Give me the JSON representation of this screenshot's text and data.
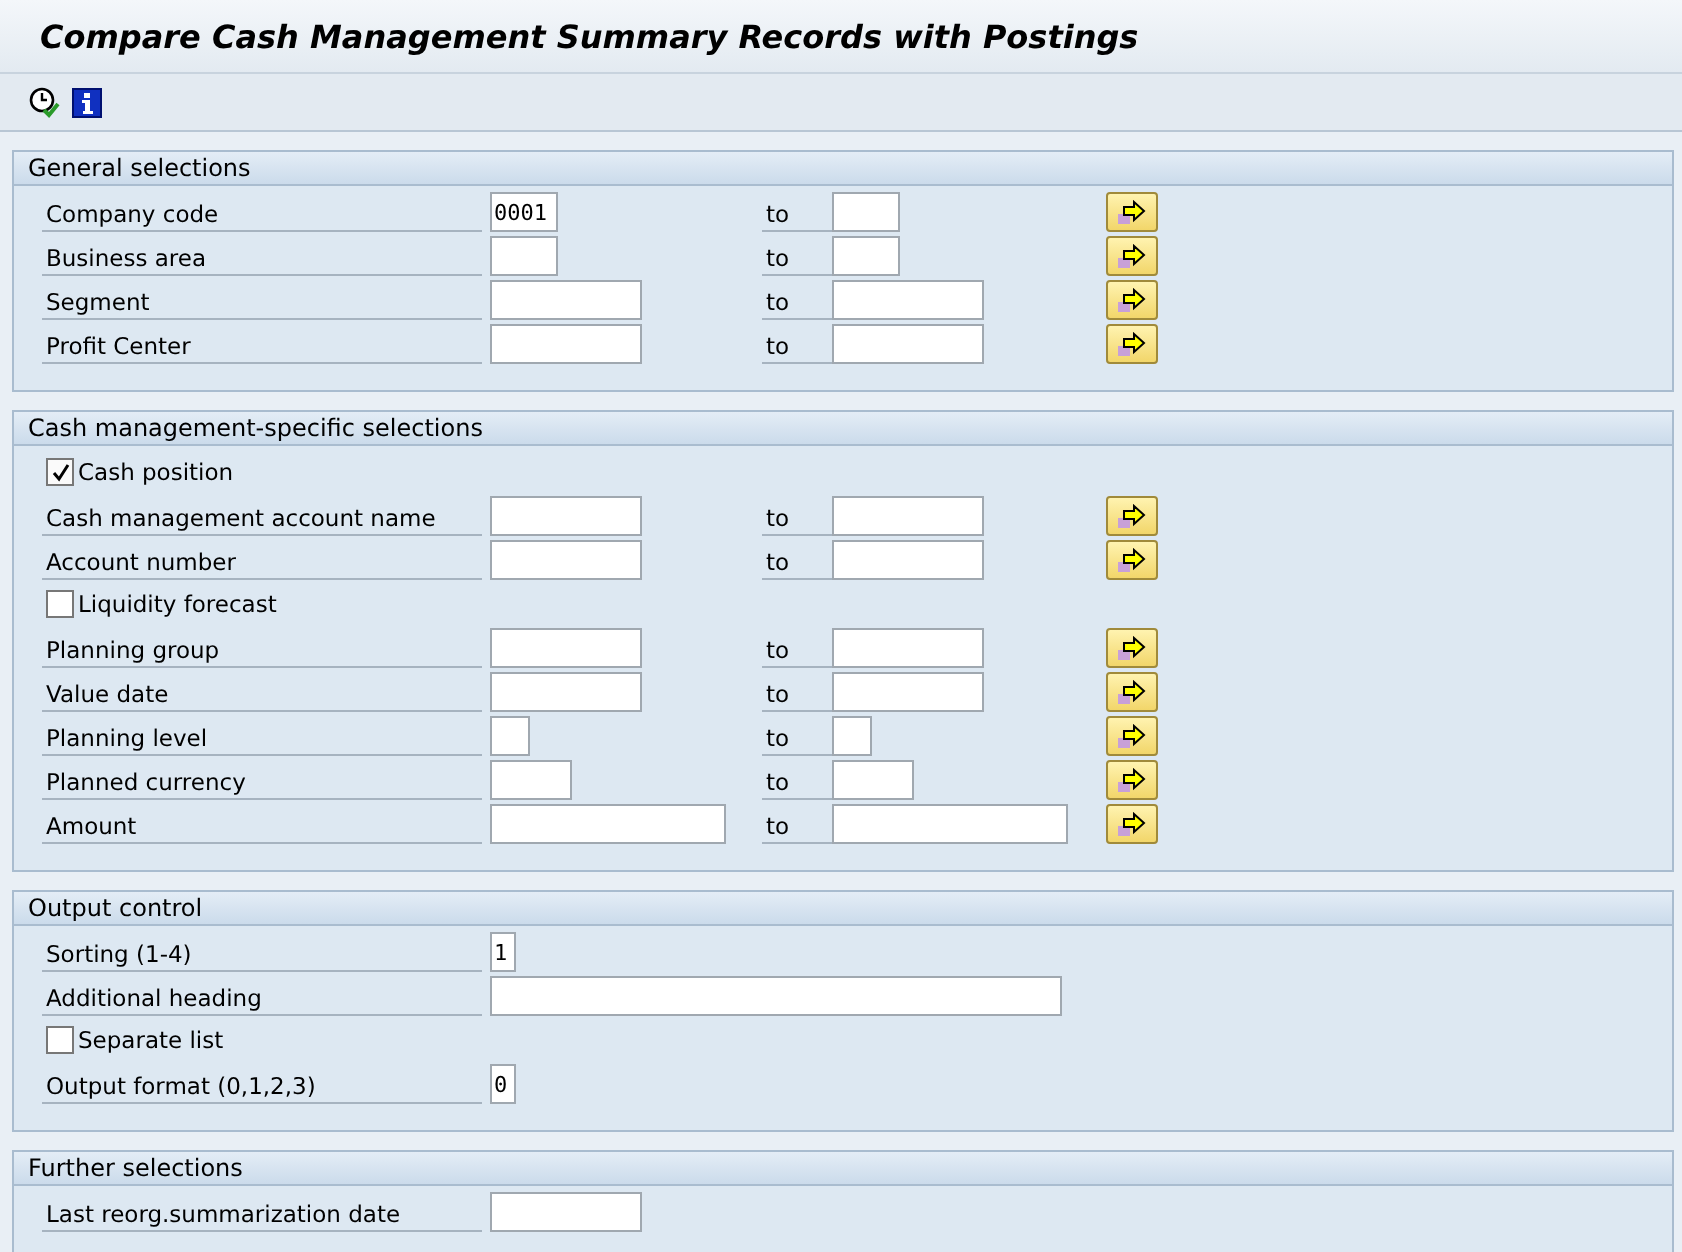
{
  "window": {
    "title": "Compare Cash Management Summary Records with Postings"
  },
  "toolbar": {
    "buttons": [
      {
        "kind": "execute"
      },
      {
        "kind": "info"
      }
    ]
  },
  "sections": [
    {
      "title": "General selections",
      "rows": [
        {
          "kind": "range",
          "label": "Company code",
          "value": "0001",
          "to_label": "to"
        },
        {
          "kind": "range",
          "label": "Business area",
          "to_label": "to"
        },
        {
          "kind": "range",
          "label": "Segment",
          "to_label": "to"
        },
        {
          "kind": "range",
          "label": "Profit Center",
          "to_label": "to"
        }
      ]
    },
    {
      "title": "Cash management-specific selections",
      "rows": [
        {
          "kind": "checkbox",
          "label": "Cash position",
          "checked": true
        },
        {
          "kind": "range",
          "label": "Cash management account name",
          "to_label": "to"
        },
        {
          "kind": "range",
          "label": "Account number",
          "to_label": "to"
        },
        {
          "kind": "checkbox",
          "label": "Liquidity forecast",
          "checked": false
        },
        {
          "kind": "range",
          "label": "Planning group",
          "to_label": "to"
        },
        {
          "kind": "range",
          "label": "Value date",
          "to_label": "to"
        },
        {
          "kind": "range",
          "label": "Planning level",
          "to_label": "to"
        },
        {
          "kind": "range",
          "label": "Planned currency",
          "to_label": "to"
        },
        {
          "kind": "range",
          "label": "Amount",
          "to_label": "to"
        }
      ]
    },
    {
      "title": "Output control",
      "rows": [
        {
          "kind": "single",
          "label": "Sorting (1-4)",
          "value": "1"
        },
        {
          "kind": "single",
          "label": "Additional heading"
        },
        {
          "kind": "checkbox",
          "label": "Separate list",
          "checked": false
        },
        {
          "kind": "single",
          "label": "Output format (0,1,2,3)",
          "value": "0"
        }
      ]
    },
    {
      "title": "Further selections",
      "rows": [
        {
          "kind": "single",
          "label": "Last reorg.summarization date"
        }
      ]
    }
  ]
}
